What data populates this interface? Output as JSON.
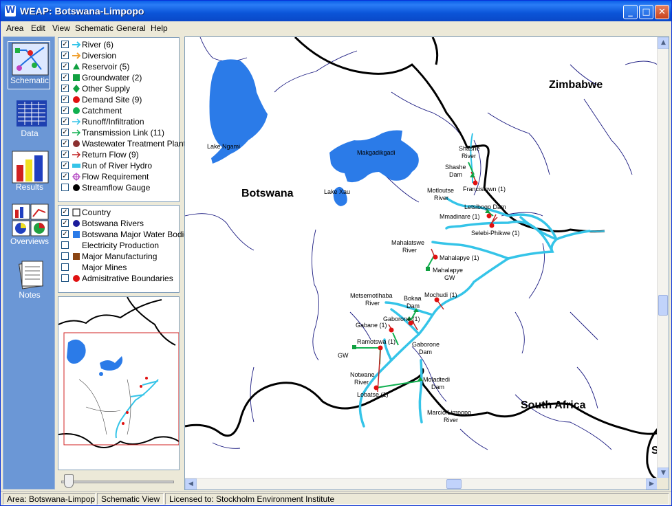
{
  "window": {
    "title": "WEAP: Botswana-Limpopo",
    "app_icon": "W"
  },
  "menu": [
    "Area",
    "Edit",
    "View",
    "Schematic",
    "General",
    "Help"
  ],
  "views": [
    {
      "label": "Schematic",
      "icon": "schematic-icon",
      "selected": true
    },
    {
      "label": "Data",
      "icon": "data-icon"
    },
    {
      "label": "Results",
      "icon": "results-icon"
    },
    {
      "label": "Overviews",
      "icon": "overviews-icon"
    },
    {
      "label": "Notes",
      "icon": "notes-icon"
    }
  ],
  "legend_objects": [
    {
      "label": "River (6)",
      "checked": true,
      "symbol": "river-arrow",
      "color": "#35c4e8"
    },
    {
      "label": "Diversion",
      "checked": true,
      "symbol": "diversion-arrow",
      "color": "#f0a030"
    },
    {
      "label": "Reservoir (5)",
      "checked": true,
      "symbol": "triangle",
      "color": "#10a040"
    },
    {
      "label": "Groundwater (2)",
      "checked": true,
      "symbol": "square",
      "color": "#10a040"
    },
    {
      "label": "Other Supply",
      "checked": true,
      "symbol": "diamond",
      "color": "#10a040"
    },
    {
      "label": "Demand Site (9)",
      "checked": true,
      "symbol": "circle",
      "color": "#e01010"
    },
    {
      "label": "Catchment",
      "checked": true,
      "symbol": "circle",
      "color": "#10b050"
    },
    {
      "label": "Runoff/Infiltration",
      "checked": true,
      "symbol": "runoff-arrow",
      "color": "#35c4e8"
    },
    {
      "label": "Transmission Link (11)",
      "checked": true,
      "symbol": "transmission-arrow",
      "color": "#10b050"
    },
    {
      "label": "Wastewater Treatment Plant",
      "checked": true,
      "symbol": "circle",
      "color": "#8b3030"
    },
    {
      "label": "Return Flow (9)",
      "checked": true,
      "symbol": "return-arrow",
      "color": "#c02020"
    },
    {
      "label": "Run of River Hydro",
      "checked": true,
      "symbol": "bar",
      "color": "#35c4e8"
    },
    {
      "label": "Flow Requirement",
      "checked": true,
      "symbol": "flow-req",
      "color": "#b040c0"
    },
    {
      "label": "Streamflow Gauge",
      "checked": false,
      "symbol": "circle",
      "color": "#000000"
    }
  ],
  "legend_layers": [
    {
      "label": "Country",
      "checked": true,
      "symbol": "outline-square",
      "color": "#000000"
    },
    {
      "label": "Botswana Rivers",
      "checked": true,
      "symbol": "circle",
      "color": "#1a1a9a"
    },
    {
      "label": "Botswana Major Water Bodies",
      "checked": true,
      "symbol": "square",
      "color": "#2b7be8"
    },
    {
      "label": "Electricity Production",
      "checked": false,
      "symbol": "none",
      "color": ""
    },
    {
      "label": "Major Manufacturing",
      "checked": false,
      "symbol": "square",
      "color": "#8b4513"
    },
    {
      "label": "Major Mines",
      "checked": false,
      "symbol": "none",
      "color": ""
    },
    {
      "label": "Admisitrative Boundaries",
      "checked": false,
      "symbol": "circle",
      "color": "#e01010"
    }
  ],
  "map": {
    "countries": [
      "Zimbabwe",
      "Botswana",
      "South Africa",
      "S"
    ],
    "water_bodies": [
      "Lake Ngami",
      "Makgadikgadi",
      "Lake Xau"
    ],
    "labels": {
      "shashe_river": [
        "Shashe",
        "River"
      ],
      "shashe_dam": [
        "Shashe",
        "Dam"
      ],
      "francistown": "Francistown (1)",
      "motloutse_river": [
        "Motloutse",
        "River"
      ],
      "letsibogo_dam": "Letsibogo Dam",
      "mmadinare": "Mmadinare (1)",
      "selebi_phikwe": "Selebi-Phikwe (1)",
      "mahalatswe_river": [
        "Mahalatswe",
        "River"
      ],
      "mahalapye": "Mahalapye (1)",
      "mahalapye_gw": [
        "Mahalapye",
        "GW"
      ],
      "metsemotlhaba_river": [
        "Metsemotlhaba",
        "River"
      ],
      "bokaa_dam": [
        "Bokaa",
        "Dam"
      ],
      "mochudi": "Mochudi (1)",
      "gaborone": "Gaborone (1)",
      "gabane": "Gabane (1)",
      "ramotswa": "Ramotswa (1)",
      "gw": "GW",
      "gaborone_dam": [
        "Gaborone",
        "Dam"
      ],
      "notwane_river": [
        "Notwane",
        "River"
      ],
      "lobatse": "Lobatse (1)",
      "moladtedi_dam": [
        "Moladtedi",
        "Dam"
      ],
      "marico_limpopo_river": [
        "Marcio/Limpopo",
        "River"
      ]
    }
  },
  "status": {
    "area": "Area: Botswana-Limpopo",
    "view": "Schematic View",
    "license": "Licensed to: Stockholm Environment Institute"
  }
}
